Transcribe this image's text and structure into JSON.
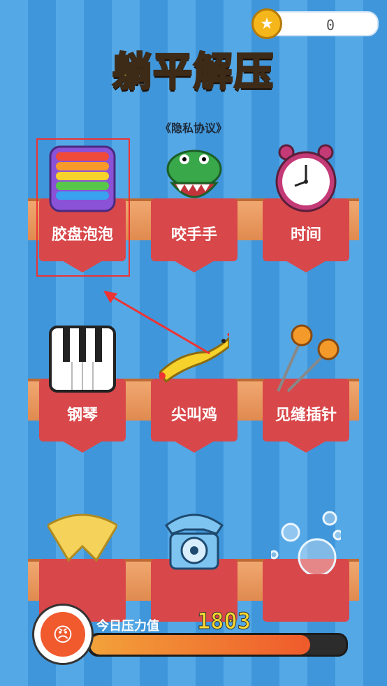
{
  "coins": {
    "value": "0",
    "icon": "star-coin-icon"
  },
  "title": "躺平解压",
  "privacy_link": "《隐私协议》",
  "games": [
    {
      "label": "胶盘泡泡",
      "icon": "pop-it-icon"
    },
    {
      "label": "咬手手",
      "icon": "crocodile-icon"
    },
    {
      "label": "时间",
      "icon": "alarm-clock-icon"
    },
    {
      "label": "钢琴",
      "icon": "piano-icon"
    },
    {
      "label": "尖叫鸡",
      "icon": "rubber-chicken-icon"
    },
    {
      "label": "见缝插针",
      "icon": "pins-icon"
    },
    {
      "label": "",
      "icon": "pizza-icon"
    },
    {
      "label": "",
      "icon": "telephone-icon"
    },
    {
      "label": "",
      "icon": "bubbles-icon"
    }
  ],
  "pressure": {
    "label": "今日压力值",
    "value": "1803",
    "fill_fraction": 0.86,
    "icon": "angry-face-icon"
  },
  "colors": {
    "accent_red": "#d8474a",
    "background_blue": "#4aa0e0",
    "highlight_red": "#ee3333"
  }
}
